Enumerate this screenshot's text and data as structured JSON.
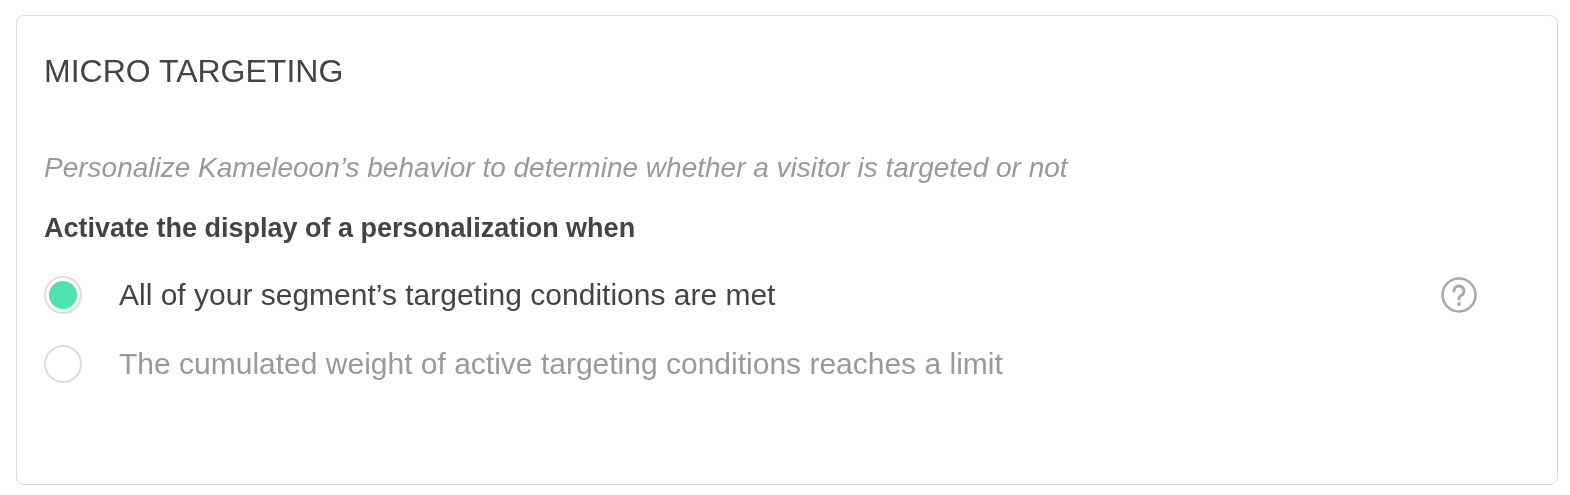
{
  "card": {
    "title": "MICRO TARGETING",
    "description": "Personalize Kameleoon’s behavior to determine whether a visitor is targeted or not",
    "question": "Activate the display of a personalization when",
    "options": [
      {
        "label": "All of your segment’s targeting conditions are met",
        "selected": true,
        "help": true
      },
      {
        "label": "The cumulated weight of active targeting conditions reaches a limit",
        "selected": false,
        "help": false
      }
    ]
  }
}
